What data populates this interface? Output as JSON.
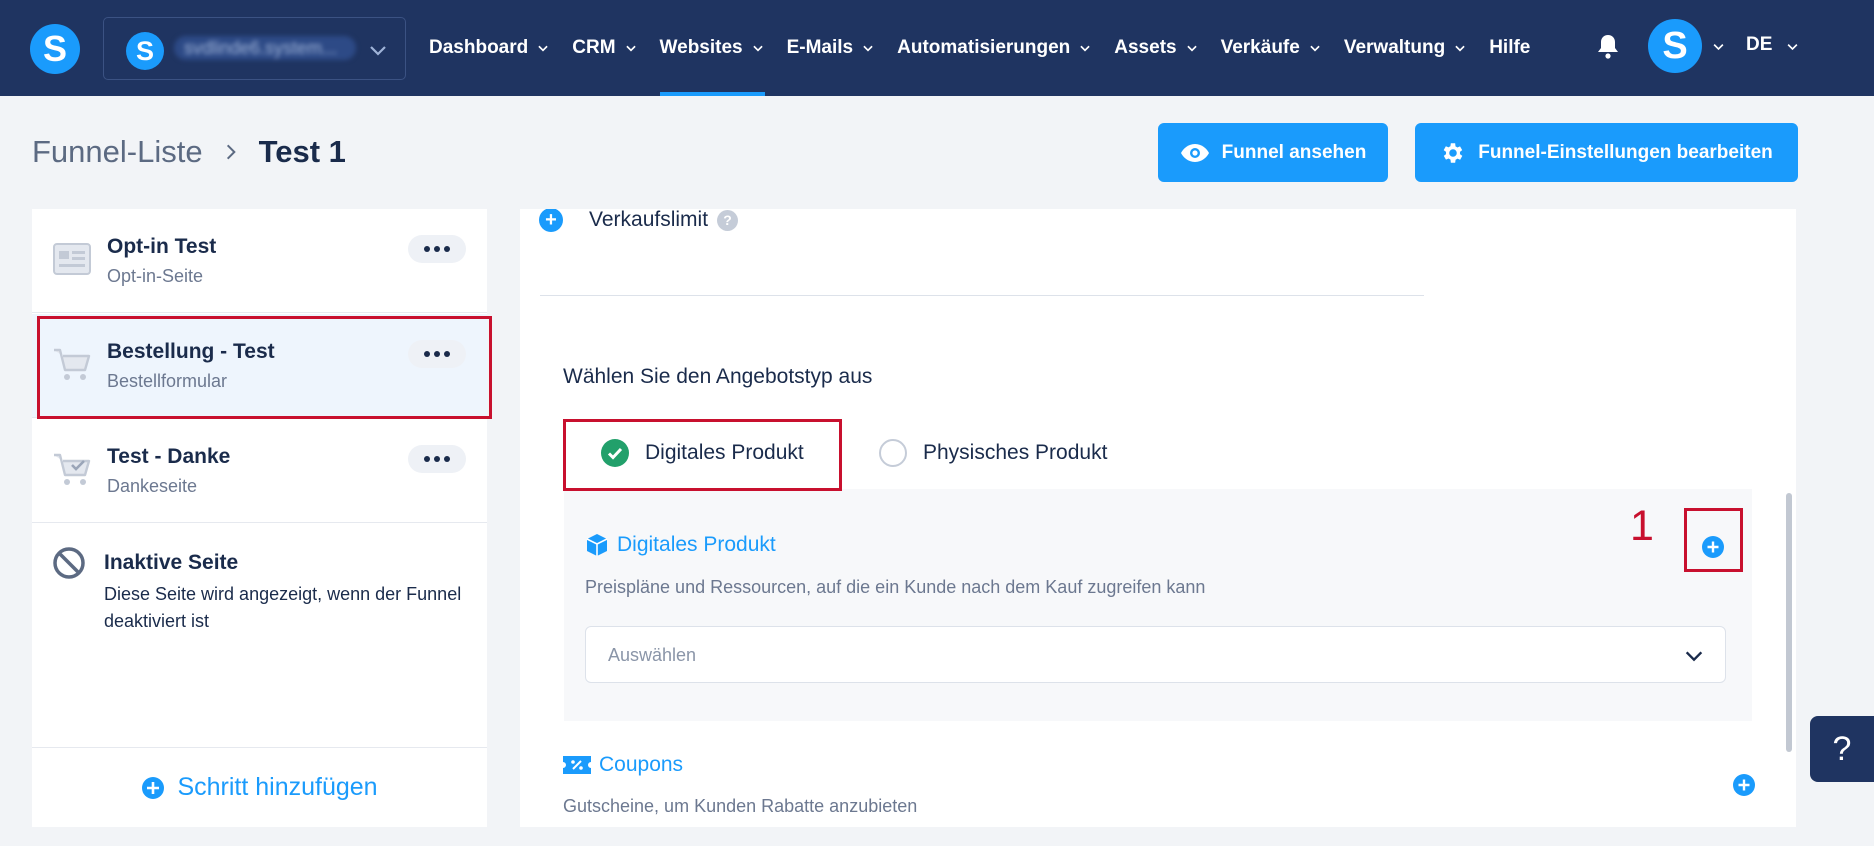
{
  "navbar": {
    "logo_letter": "S",
    "workspace": {
      "avatar_letter": "S",
      "name": "svdlinde6.system..."
    },
    "items": [
      {
        "label": "Dashboard",
        "active": false
      },
      {
        "label": "CRM",
        "active": false
      },
      {
        "label": "Websites",
        "active": true
      },
      {
        "label": "E-Mails",
        "active": false
      },
      {
        "label": "Automatisierungen",
        "active": false
      },
      {
        "label": "Assets",
        "active": false
      },
      {
        "label": "Verkäufe",
        "active": false
      },
      {
        "label": "Verwaltung",
        "active": false
      }
    ],
    "help_label": "Hilfe",
    "user_avatar_letter": "S",
    "language": "DE"
  },
  "header": {
    "breadcrumb_parent": "Funnel-Liste",
    "breadcrumb_current": "Test 1",
    "view_button": "Funnel ansehen",
    "settings_button": "Funnel-Einstellungen bearbeiten"
  },
  "sidebar": {
    "steps": [
      {
        "title": "Opt-in Test",
        "subtitle": "Opt-in-Seite",
        "icon": "optin-page-icon"
      },
      {
        "title": "Bestellung - Test",
        "subtitle": "Bestellformular",
        "icon": "cart-icon"
      },
      {
        "title": "Test - Danke",
        "subtitle": "Dankeseite",
        "icon": "cart-check-icon"
      }
    ],
    "inactive": {
      "title": "Inaktive Seite",
      "description": "Diese Seite wird angezeigt, wenn der Funnel deaktiviert ist"
    },
    "add_step": "Schritt hinzufügen"
  },
  "main": {
    "sales_limit_label": "Verkaufslimit",
    "help_glyph": "?",
    "offer_type_label": "Wählen Sie den Angebotstyp aus",
    "options": [
      {
        "label": "Digitales Produkt",
        "selected": true
      },
      {
        "label": "Physisches Produkt",
        "selected": false
      }
    ],
    "digital_product": {
      "title": "Digitales Produkt",
      "description": "Preispläne und Ressourcen, auf die ein Kunde nach dem Kauf zugreifen kann",
      "select_placeholder": "Auswählen"
    },
    "coupons": {
      "title": "Coupons",
      "description": "Gutscheine, um Kunden Rabatte anzubieten"
    }
  },
  "annotation": {
    "number": "1",
    "color": "#c8102e"
  },
  "colors": {
    "navbar": "#1f3461",
    "accent": "#1a9bfc",
    "success": "#22a06b",
    "highlight": "#c8102e"
  },
  "help_tab_label": "?"
}
